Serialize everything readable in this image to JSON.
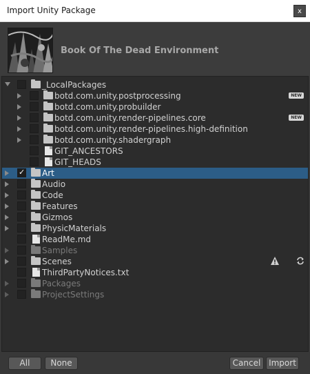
{
  "window": {
    "title": "Import Unity Package",
    "close_label": "x"
  },
  "header": {
    "package_name": "Book Of The Dead Environment"
  },
  "tree": {
    "rows": [
      {
        "label": "_LocalPackages",
        "depth": 0,
        "foldout": "open",
        "checked": false,
        "icon": "folder",
        "dim": false
      },
      {
        "label": "botd.com.unity.postprocessing",
        "depth": 1,
        "foldout": "closed",
        "checked": false,
        "icon": "folder",
        "dim": false,
        "badge": "NEW"
      },
      {
        "label": "botd.com.unity.probuilder",
        "depth": 1,
        "foldout": "closed",
        "checked": false,
        "icon": "folder",
        "dim": false
      },
      {
        "label": "botd.com.unity.render-pipelines.core",
        "depth": 1,
        "foldout": "closed",
        "checked": false,
        "icon": "folder",
        "dim": false,
        "badge": "NEW"
      },
      {
        "label": "botd.com.unity.render-pipelines.high-definition",
        "depth": 1,
        "foldout": "closed",
        "checked": false,
        "icon": "folder",
        "dim": false
      },
      {
        "label": "botd.com.unity.shadergraph",
        "depth": 1,
        "foldout": "closed",
        "checked": false,
        "icon": "folder",
        "dim": false
      },
      {
        "label": "GIT_ANCESTORS",
        "depth": 1,
        "foldout": "none",
        "checked": false,
        "icon": "file",
        "dim": false
      },
      {
        "label": "GIT_HEADS",
        "depth": 1,
        "foldout": "none",
        "checked": false,
        "icon": "file",
        "dim": false
      },
      {
        "label": "Art",
        "depth": 0,
        "foldout": "closed",
        "checked": true,
        "icon": "folder",
        "dim": false,
        "selected": true
      },
      {
        "label": "Audio",
        "depth": 0,
        "foldout": "closed",
        "checked": false,
        "icon": "folder",
        "dim": false
      },
      {
        "label": "Code",
        "depth": 0,
        "foldout": "closed",
        "checked": false,
        "icon": "folder",
        "dim": false
      },
      {
        "label": "Features",
        "depth": 0,
        "foldout": "closed",
        "checked": false,
        "icon": "folder",
        "dim": false
      },
      {
        "label": "Gizmos",
        "depth": 0,
        "foldout": "closed",
        "checked": false,
        "icon": "folder",
        "dim": false
      },
      {
        "label": "PhysicMaterials",
        "depth": 0,
        "foldout": "closed",
        "checked": false,
        "icon": "folder",
        "dim": false
      },
      {
        "label": "ReadMe.md",
        "depth": 0,
        "foldout": "none",
        "checked": false,
        "icon": "file",
        "dim": false
      },
      {
        "label": "Samples",
        "depth": 0,
        "foldout": "closed",
        "checked": false,
        "icon": "folder",
        "dim": true
      },
      {
        "label": "Scenes",
        "depth": 0,
        "foldout": "closed",
        "checked": false,
        "icon": "folder",
        "dim": false,
        "status_icons": [
          "warning-icon",
          "sync-icon"
        ]
      },
      {
        "label": "ThirdPartyNotices.txt",
        "depth": 0,
        "foldout": "none",
        "checked": false,
        "icon": "file",
        "dim": false
      },
      {
        "label": "Packages",
        "depth": 0,
        "foldout": "closed",
        "checked": false,
        "icon": "folder",
        "dim": true
      },
      {
        "label": "ProjectSettings",
        "depth": 0,
        "foldout": "closed",
        "checked": false,
        "icon": "folder",
        "dim": true
      }
    ]
  },
  "footer": {
    "all_label": "All",
    "none_label": "None",
    "cancel_label": "Cancel",
    "import_label": "Import"
  },
  "colors": {
    "background": "#383838",
    "tree_background": "#2c2c2c",
    "selection": "#2c5d87",
    "titlebar": "#ffffff"
  }
}
